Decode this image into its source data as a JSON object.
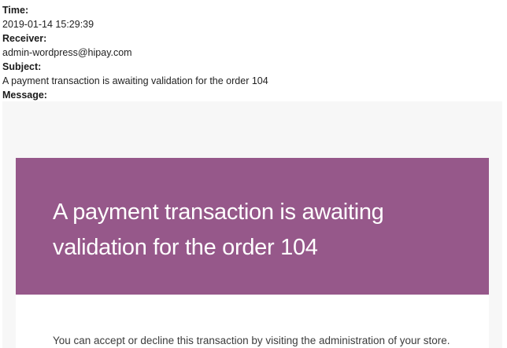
{
  "meta": {
    "time_label": "Time:",
    "time_value": "2019-01-14 15:29:39",
    "receiver_label": "Receiver:",
    "receiver_value": "admin-wordpress@hipay.com",
    "subject_label": "Subject:",
    "subject_value": "A payment transaction is awaiting validation for the order 104",
    "message_label": "Message:"
  },
  "email": {
    "heading": "A payment transaction is awaiting validation for the order 104",
    "body_text": "You can accept or decline this transaction by visiting the administration of your store."
  },
  "colors": {
    "header_background": "#96588a",
    "frame_background": "#f7f7f7",
    "body_background": "#ffffff"
  }
}
